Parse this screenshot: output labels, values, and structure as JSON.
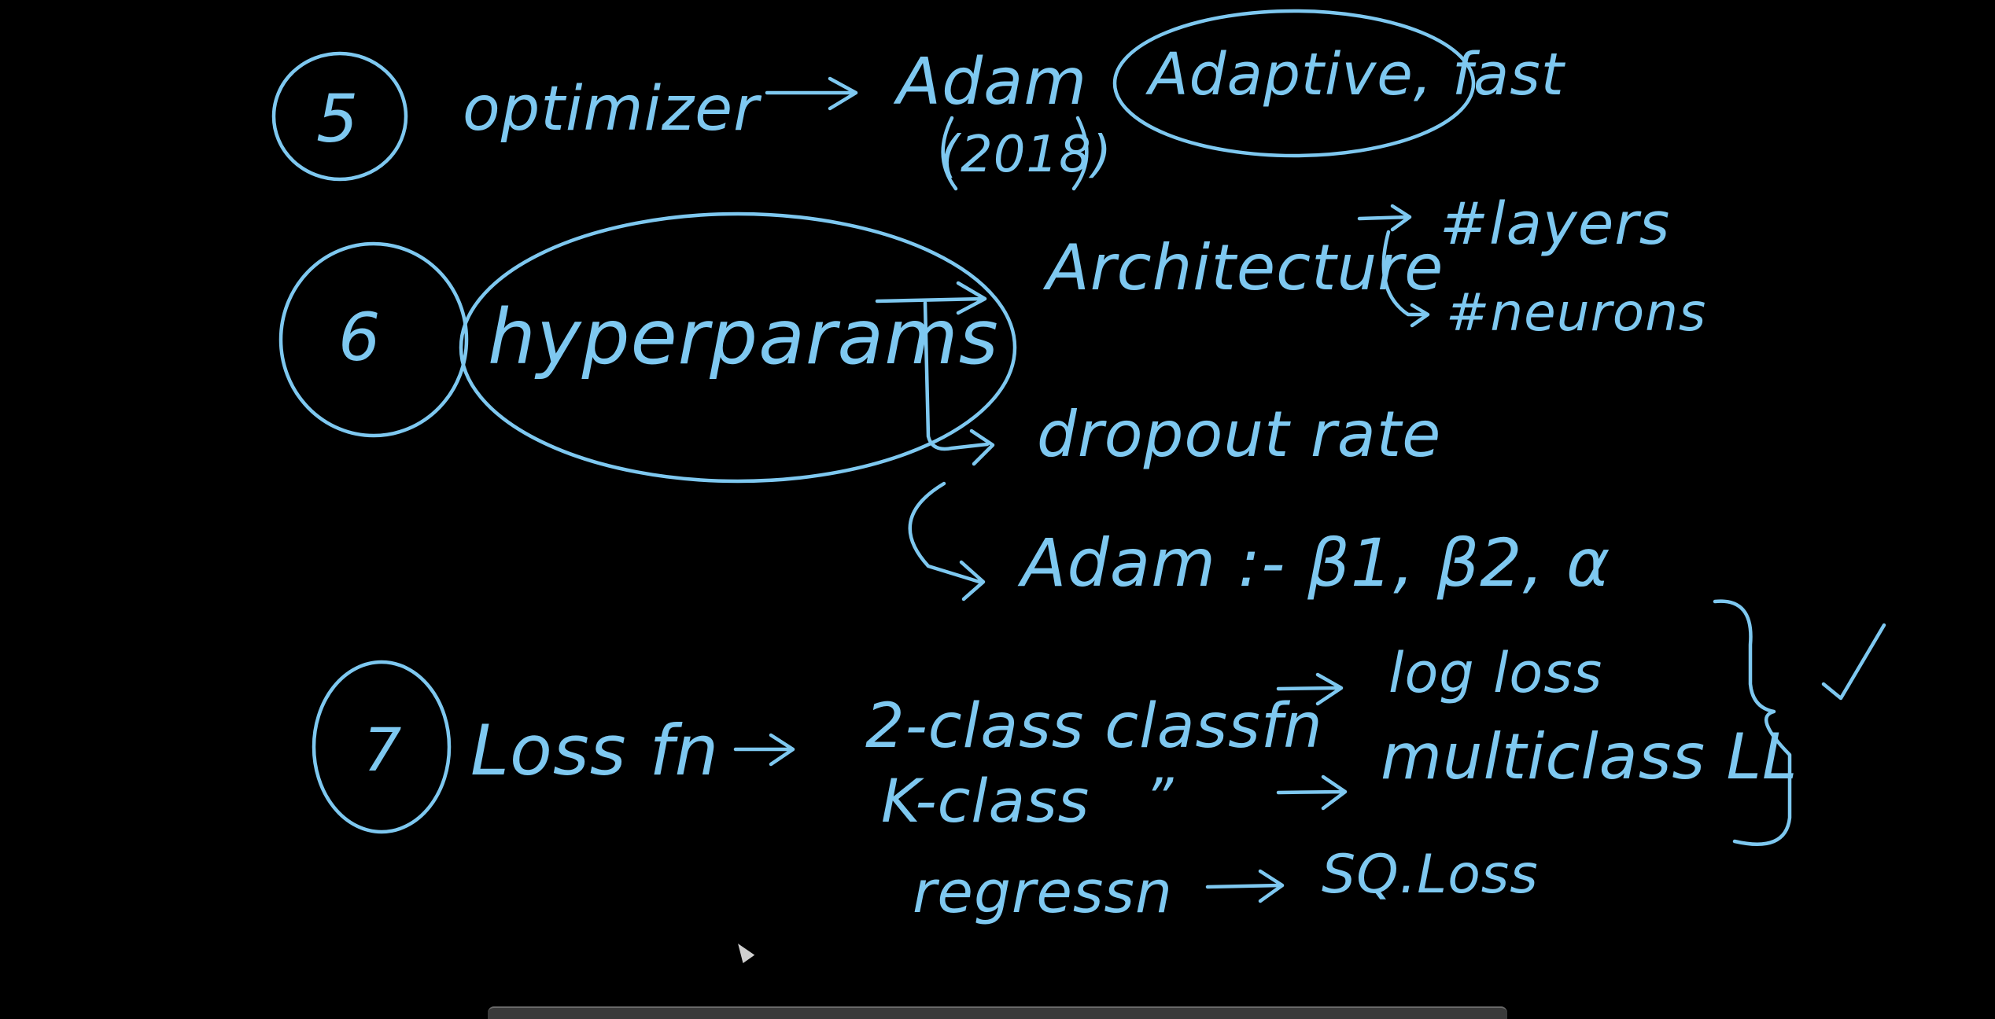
{
  "colors": {
    "background": "#000000",
    "ink": "#7ec8f0",
    "toolbar": "#3a3a3a",
    "cursor": "#cfcfcf"
  },
  "items": {
    "n5": "5",
    "optimizer": "optimizer",
    "adam": "Adam",
    "adam_year": "(2018)",
    "adaptive": "Adaptive, fast",
    "n6": "6",
    "hyperparams": "hyperparams",
    "architecture": "Architecture",
    "layers": "#layers",
    "neurons": "#neurons",
    "dropout": "dropout rate",
    "adam_params": "Adam :- β1, β2, α",
    "n7": "7",
    "loss_fn": "Loss fn",
    "two_class": "2-class classfn",
    "log_loss": "log loss",
    "k_class": "K-class",
    "ditto": "”",
    "multiclass": "multiclass LL",
    "regression": "regressn",
    "sq_loss": "SQ.Loss"
  }
}
